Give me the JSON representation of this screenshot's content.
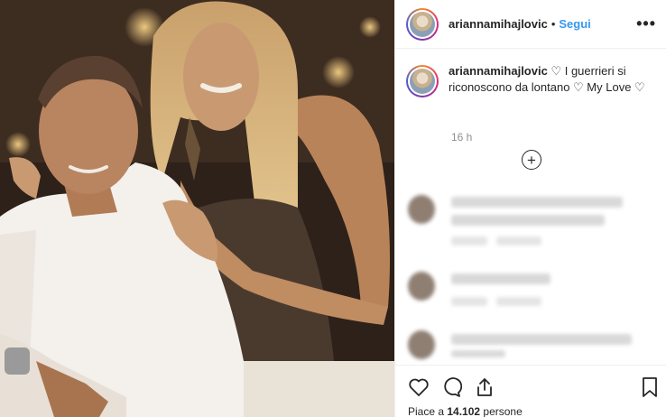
{
  "post": {
    "username": "ariannamihajlovic",
    "separator": "•",
    "follow_label": "Segui",
    "more_icon": "more-options-icon"
  },
  "caption": {
    "username": "ariannamihajlovic",
    "text": "♡ I guerrieri si riconoscono da lontano ♡ My Love ♡",
    "time": "16 h"
  },
  "load_more_icon": "plus-circle-icon",
  "likes": {
    "prefix": "Piace a ",
    "count": "14.102",
    "suffix": " persone"
  },
  "colors": {
    "accent": "#3897f0",
    "text": "#262626",
    "muted": "#8e8e8e"
  }
}
